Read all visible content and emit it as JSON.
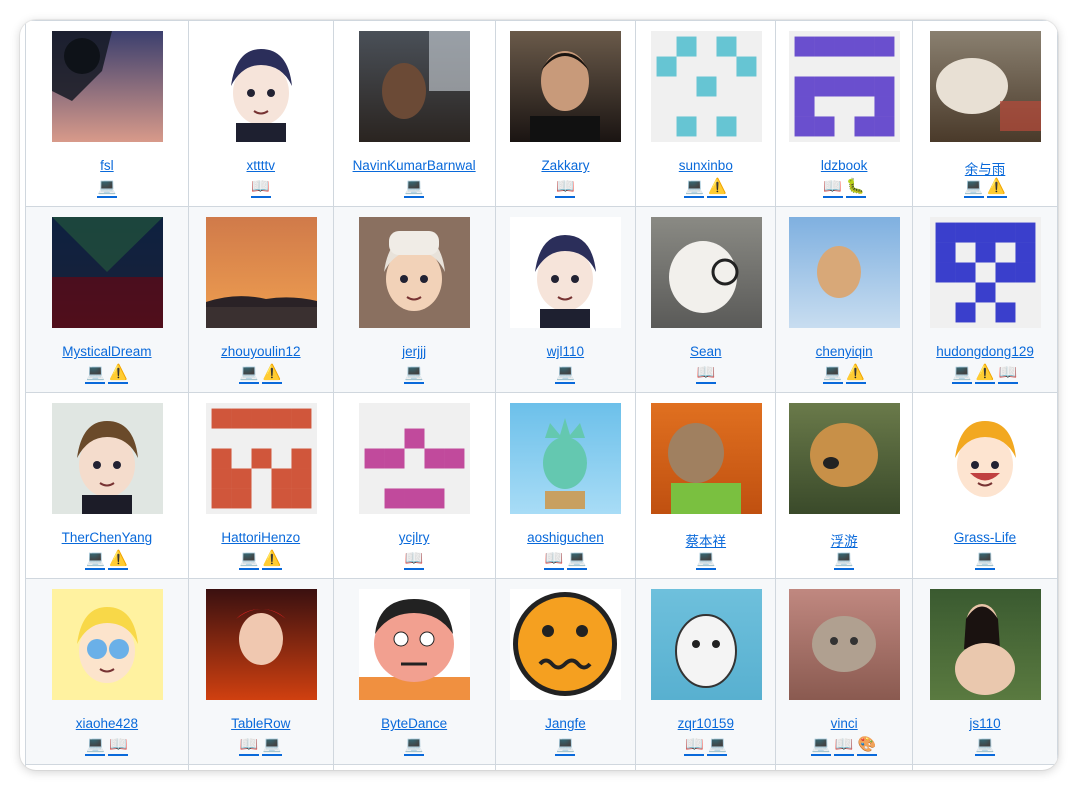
{
  "contributors": [
    [
      {
        "name": "fsl",
        "badges": [
          "code"
        ]
      },
      {
        "name": "xttttv",
        "badges": [
          "doc"
        ]
      },
      {
        "name": "NavinKumarBarnwal",
        "badges": [
          "code"
        ]
      },
      {
        "name": "Zakkary",
        "badges": [
          "doc"
        ]
      },
      {
        "name": "sunxinbo",
        "badges": [
          "code",
          "warning"
        ]
      },
      {
        "name": "ldzbook",
        "badges": [
          "doc",
          "bug"
        ]
      },
      {
        "name": "余与雨",
        "badges": [
          "code",
          "warning"
        ]
      }
    ],
    [
      {
        "name": "MysticalDream",
        "badges": [
          "code",
          "warning"
        ]
      },
      {
        "name": "zhouyoulin12",
        "badges": [
          "code",
          "warning"
        ]
      },
      {
        "name": "jerjjj",
        "badges": [
          "code"
        ]
      },
      {
        "name": "wjl110",
        "badges": [
          "code"
        ]
      },
      {
        "name": "Sean",
        "badges": [
          "doc"
        ]
      },
      {
        "name": "chenyiqin",
        "badges": [
          "code",
          "warning"
        ]
      },
      {
        "name": "hudongdong129",
        "badges": [
          "code",
          "warning",
          "doc"
        ]
      }
    ],
    [
      {
        "name": "TherChenYang",
        "badges": [
          "code",
          "warning"
        ]
      },
      {
        "name": "HattoriHenzo",
        "badges": [
          "code",
          "warning"
        ]
      },
      {
        "name": "ycjlry",
        "badges": [
          "doc"
        ]
      },
      {
        "name": "aoshiguchen",
        "badges": [
          "doc",
          "code"
        ]
      },
      {
        "name": "蔡本祥",
        "badges": [
          "code"
        ]
      },
      {
        "name": "浮游",
        "badges": [
          "code"
        ]
      },
      {
        "name": "Grass-Life",
        "badges": [
          "code"
        ]
      }
    ],
    [
      {
        "name": "xiaohe428",
        "badges": [
          "code",
          "doc"
        ]
      },
      {
        "name": "TableRow",
        "badges": [
          "doc",
          "code"
        ]
      },
      {
        "name": "ByteDance",
        "badges": [
          "code"
        ]
      },
      {
        "name": "Jangfe",
        "badges": [
          "code"
        ]
      },
      {
        "name": "zqr10159",
        "badges": [
          "doc",
          "code"
        ]
      },
      {
        "name": "vinci",
        "badges": [
          "code",
          "doc",
          "design"
        ]
      },
      {
        "name": "js110",
        "badges": [
          "code"
        ]
      }
    ]
  ],
  "badge_glyphs": {
    "code": "💻",
    "doc": "📖",
    "warning": "⚠️",
    "bug": "🐛",
    "design": "🎨"
  },
  "avatar_icons": [
    [
      "tree-sunset-photo",
      "anime-boy-avatar",
      "selfie-photo",
      "man-portrait-photo",
      "identicon-cyan",
      "identicon-purple",
      "plush-toy-photo"
    ],
    [
      "matrix-code-art",
      "sunset-photo",
      "anime-boy-cap-avatar",
      "anime-boy-avatar",
      "rabbit-glasses-photo",
      "flying-cat-photo",
      "identicon-blue"
    ],
    [
      "anime-boy-suit-avatar",
      "identicon-red",
      "identicon-pink",
      "statue-of-liberty-cartoon",
      "sloth-photo",
      "dog-photo",
      "anime-girl-avatar"
    ],
    [
      "star-cartoon-avatar",
      "anime-fire-avatar",
      "gian-cartoon-avatar",
      "emoji-face-avatar",
      "panda-sticker-avatar",
      "cat-photo",
      "woman-photo"
    ]
  ],
  "colors": {
    "link": "#0969da",
    "border": "#d0d7de",
    "stripe": "#f6f8fa"
  }
}
